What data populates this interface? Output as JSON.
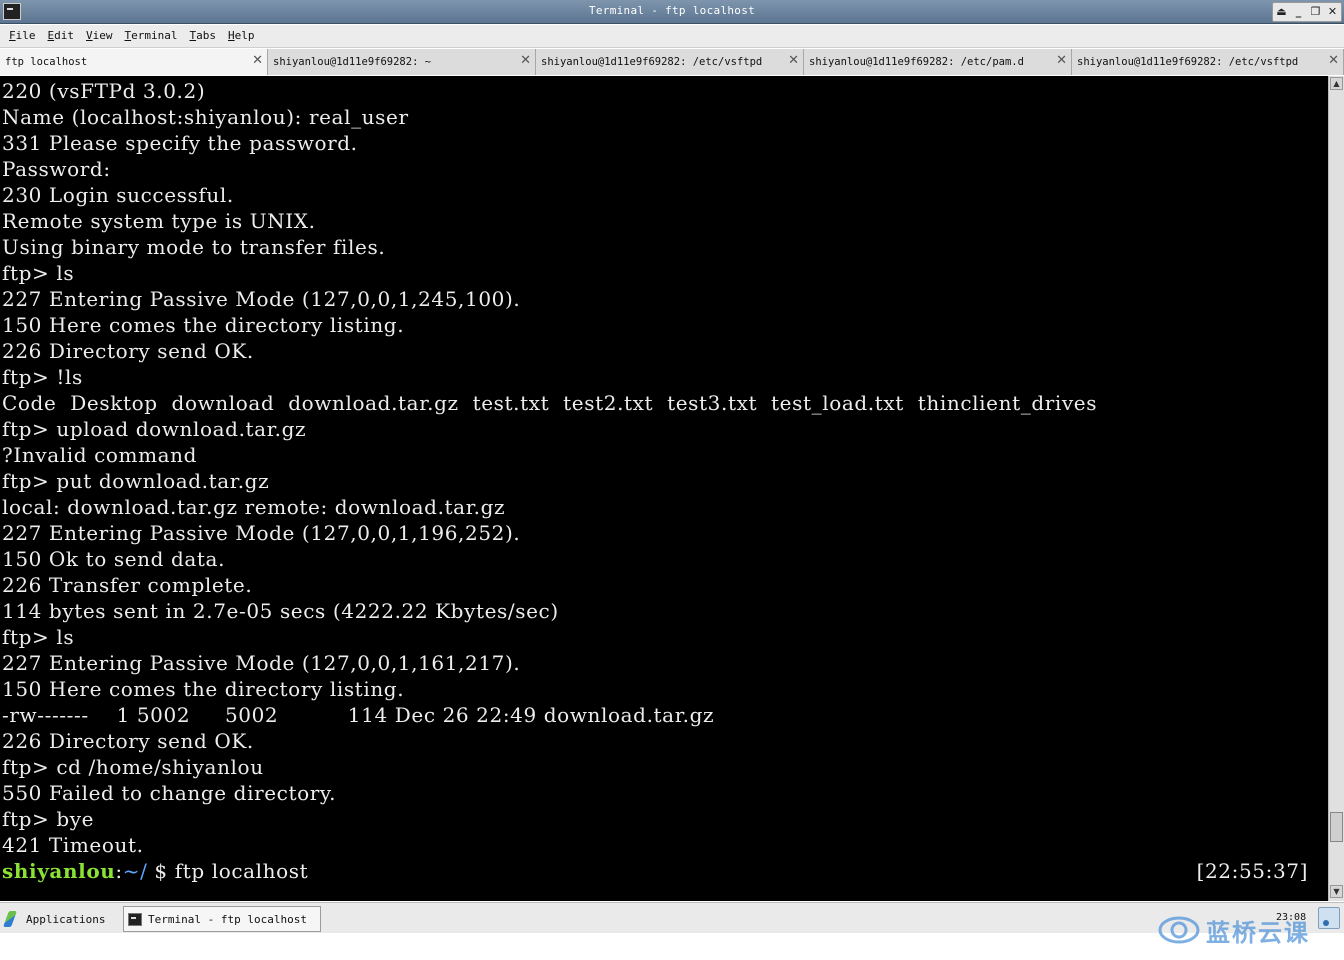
{
  "window": {
    "title": "Terminal - ftp localhost",
    "controls": [
      "⏏",
      "_",
      "❐",
      "✕"
    ]
  },
  "menu": [
    {
      "label": "File",
      "acc": "F",
      "rest": "ile"
    },
    {
      "label": "Edit",
      "acc": "E",
      "rest": "dit"
    },
    {
      "label": "View",
      "acc": "V",
      "rest": "iew"
    },
    {
      "label": "Terminal",
      "acc": "T",
      "rest": "erminal"
    },
    {
      "label": "Tabs",
      "acc": "T",
      "rest": "abs"
    },
    {
      "label": "Help",
      "acc": "H",
      "rest": "elp"
    }
  ],
  "tabs": [
    {
      "label": "ftp localhost",
      "active": true
    },
    {
      "label": "shiyanlou@1d11e9f69282: ~",
      "active": false
    },
    {
      "label": "shiyanlou@1d11e9f69282: /etc/vsftpd",
      "active": false
    },
    {
      "label": "shiyanlou@1d11e9f69282: /etc/pam.d",
      "active": false
    },
    {
      "label": "shiyanlou@1d11e9f69282: /etc/vsftpd",
      "active": false
    }
  ],
  "terminal": {
    "lines": [
      "220 (vsFTPd 3.0.2)",
      "Name (localhost:shiyanlou): real_user",
      "331 Please specify the password.",
      "Password:",
      "230 Login successful.",
      "Remote system type is UNIX.",
      "Using binary mode to transfer files.",
      "ftp> ls",
      "227 Entering Passive Mode (127,0,0,1,245,100).",
      "150 Here comes the directory listing.",
      "226 Directory send OK.",
      "ftp> !ls",
      "Code  Desktop  download  download.tar.gz  test.txt  test2.txt  test3.txt  test_load.txt  thinclient_drives",
      "ftp> upload download.tar.gz",
      "?Invalid command",
      "ftp> put download.tar.gz",
      "local: download.tar.gz remote: download.tar.gz",
      "227 Entering Passive Mode (127,0,0,1,196,252).",
      "150 Ok to send data.",
      "226 Transfer complete.",
      "114 bytes sent in 2.7e-05 secs (4222.22 Kbytes/sec)",
      "ftp> ls",
      "227 Entering Passive Mode (127,0,0,1,161,217).",
      "150 Here comes the directory listing.",
      "-rw-------    1 5002     5002          114 Dec 26 22:49 download.tar.gz",
      "226 Directory send OK.",
      "ftp> cd /home/shiyanlou",
      "550 Failed to change directory.",
      "ftp> bye",
      "421 Timeout."
    ],
    "prompt": {
      "user": "shiyanlou",
      "sep": ":",
      "path": "~/",
      "command": " $ ftp localhost",
      "time": "[22:55:37]"
    }
  },
  "taskbar": {
    "apps_label": "Applications",
    "task_label": "Terminal - ftp localhost",
    "clock": "23:08"
  },
  "watermark": {
    "text": "蓝桥云课"
  }
}
